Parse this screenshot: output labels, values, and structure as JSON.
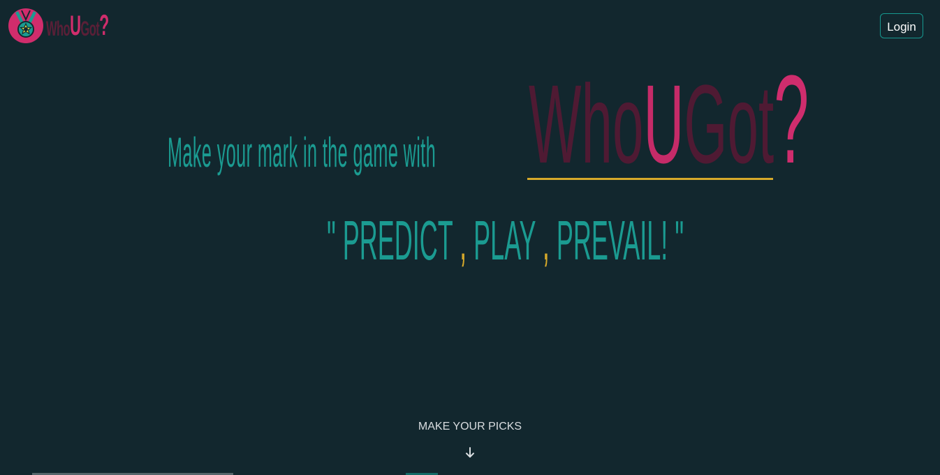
{
  "header": {
    "logo": {
      "icon": "medal-star-icon",
      "who": "Who",
      "u": "U",
      "got": "Got",
      "q": "?"
    },
    "login_label": "Login"
  },
  "hero": {
    "tagline": "Make your mark in the game with",
    "brand": {
      "who": "Who",
      "u": "U",
      "got": "Got",
      "q": "?"
    },
    "slogan": {
      "open_quote": "\"",
      "word1": "PREDICT",
      "sep1": ",",
      "word2": "PLAY",
      "sep2": ",",
      "word3": "PREVAIL!",
      "close_quote": "\""
    }
  },
  "cta": {
    "label": "MAKE YOUR PICKS",
    "icon": "arrow-down-icon"
  },
  "colors": {
    "background": "#12272e",
    "teal": "#1b9b91",
    "pink": "#cf2d6d",
    "maroon": "#4f1a33",
    "gold": "#d6a92a"
  }
}
